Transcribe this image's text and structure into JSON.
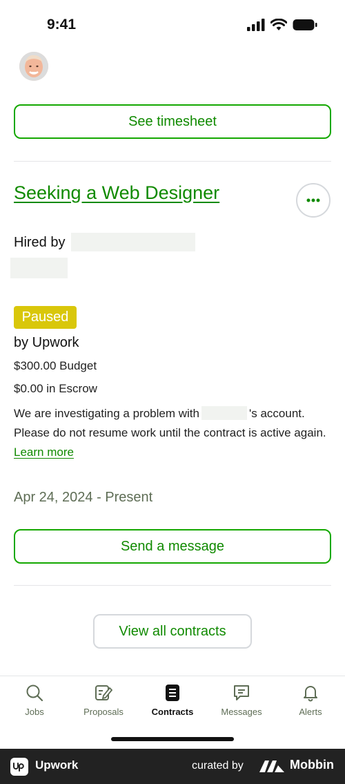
{
  "status_bar": {
    "time": "9:41"
  },
  "timesheet_button": "See timesheet",
  "contract": {
    "title": "Seeking a Web Designer",
    "hired_by_label": "Hired by",
    "status_badge": "Paused",
    "paused_by": "by Upwork",
    "budget": "$300.00 Budget",
    "escrow": "$0.00 in Escrow",
    "notice_part1": "We are investigating a problem with",
    "notice_part2": "'s account. Please do not resume work until the contract is active again.",
    "learn_more": "Learn more",
    "date_range": "Apr 24, 2024 - Present"
  },
  "send_message_button": "Send a message",
  "view_all_button": "View all contracts",
  "tab_bar": {
    "tabs": [
      {
        "label": "Jobs",
        "icon": "search-icon"
      },
      {
        "label": "Proposals",
        "icon": "proposals-icon"
      },
      {
        "label": "Contracts",
        "icon": "contracts-icon",
        "active": true
      },
      {
        "label": "Messages",
        "icon": "messages-icon"
      },
      {
        "label": "Alerts",
        "icon": "bell-icon"
      }
    ]
  },
  "footer": {
    "app_name": "Upwork",
    "curated_by": "curated by",
    "brand": "Mobbin"
  },
  "colors": {
    "accent": "#14a800",
    "accent_text": "#108a00",
    "badge": "#d9c70a",
    "footer_bg": "#222222"
  }
}
